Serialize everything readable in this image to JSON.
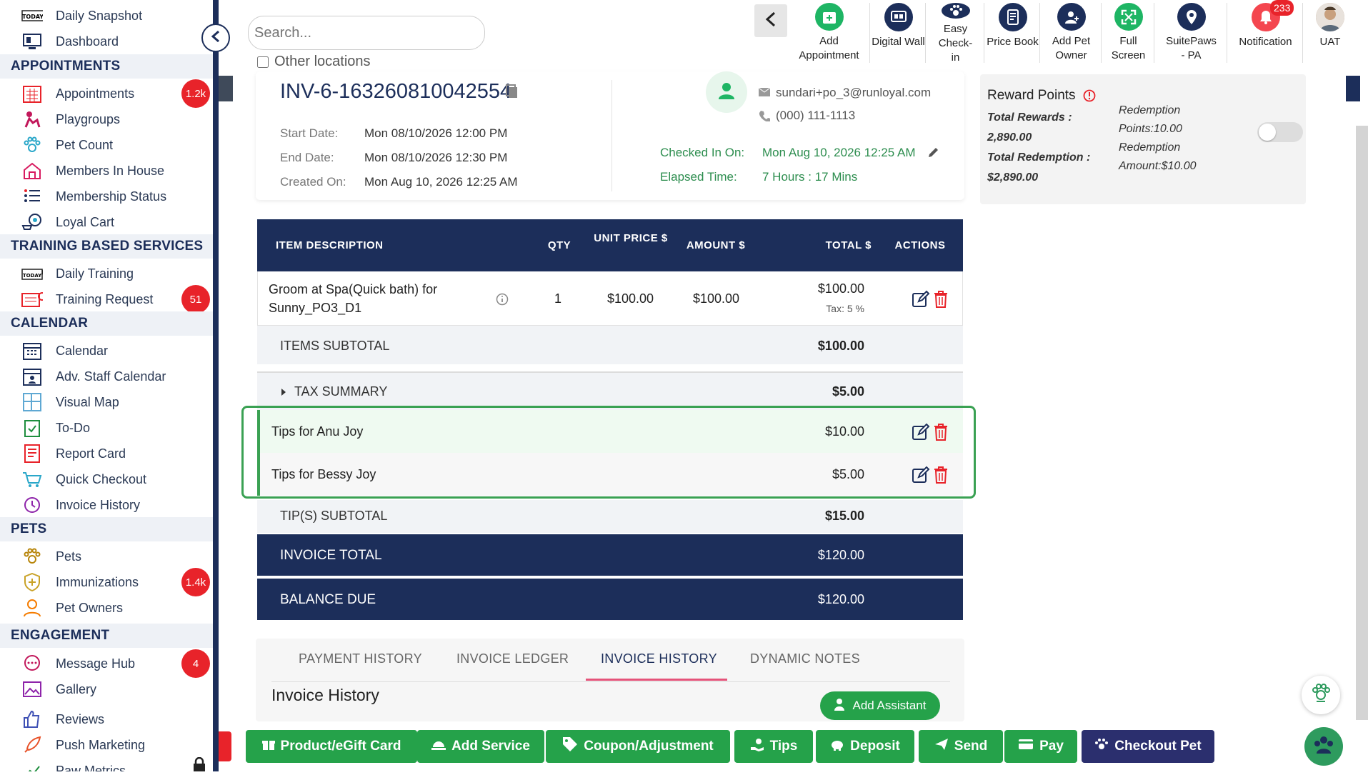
{
  "sidebar": {
    "items_top": [
      {
        "label": "Daily Snapshot",
        "icon": "today-calendar-icon"
      },
      {
        "label": "Dashboard",
        "icon": "dashboard-monitor-icon"
      }
    ],
    "sections": [
      {
        "title": "APPOINTMENTS",
        "items": [
          {
            "label": "Appointments",
            "icon": "calendar-grid-icon",
            "badge": "1.2k"
          },
          {
            "label": "Playgroups",
            "icon": "dog-play-icon"
          },
          {
            "label": "Pet Count",
            "icon": "paw-count-icon"
          },
          {
            "label": "Members In House",
            "icon": "house-icon"
          },
          {
            "label": "Membership Status",
            "icon": "list-status-icon"
          },
          {
            "label": "Loyal Cart",
            "icon": "cart-paw-icon"
          }
        ]
      },
      {
        "title": "TRAINING BASED SERVICES",
        "items": [
          {
            "label": "Daily Training",
            "icon": "today-whistle-icon"
          },
          {
            "label": "Training Request",
            "icon": "training-request-icon",
            "badge": "51"
          }
        ]
      },
      {
        "title": "CALENDAR",
        "items": [
          {
            "label": "Calendar",
            "icon": "calendar-icon"
          },
          {
            "label": "Adv. Staff Calendar",
            "icon": "staff-calendar-icon"
          },
          {
            "label": "Visual Map",
            "icon": "map-grid-icon"
          },
          {
            "label": "To-Do",
            "icon": "todo-clipboard-icon"
          },
          {
            "label": "Report Card",
            "icon": "report-card-icon"
          },
          {
            "label": "Quick Checkout",
            "icon": "quick-cart-icon"
          },
          {
            "label": "Invoice History",
            "icon": "invoice-history-icon"
          }
        ]
      },
      {
        "title": "PETS",
        "items": [
          {
            "label": "Pets",
            "icon": "paw-icon"
          },
          {
            "label": "Immunizations",
            "icon": "shield-plus-icon",
            "badge": "1.4k"
          },
          {
            "label": "Pet Owners",
            "icon": "person-icon"
          }
        ]
      },
      {
        "title": "ENGAGEMENT",
        "items": [
          {
            "label": "Message Hub",
            "icon": "chat-bubble-icon",
            "badge": "4"
          },
          {
            "label": "Gallery",
            "icon": "image-icon"
          },
          {
            "label": "Reviews",
            "icon": "thumbs-up-icon"
          },
          {
            "label": "Push Marketing",
            "icon": "rocket-icon"
          },
          {
            "label": "Paw Metrics",
            "icon": "chart-line-icon"
          }
        ]
      }
    ]
  },
  "topbar": {
    "search_placeholder": "Search...",
    "other_locations": "Other locations",
    "buttons": [
      {
        "label": "Add Appointment",
        "icon": "add-calendar-icon",
        "color": "#1eb564"
      },
      {
        "label": "Digital Wall",
        "icon": "digital-wall-icon",
        "color": "#1c2e5a"
      },
      {
        "label": "Easy Check-in",
        "icon": "paw-checkin-icon",
        "color": "#1c2e5a"
      },
      {
        "label": "Price Book",
        "icon": "price-book-icon",
        "color": "#1c2e5a"
      },
      {
        "label": "Add Pet Owner",
        "icon": "add-user-icon",
        "color": "#1c2e5a"
      },
      {
        "label": "Full Screen",
        "icon": "fullscreen-icon",
        "color": "#1eb564"
      },
      {
        "label": "SuitePaws - PA",
        "icon": "location-pin-icon",
        "color": "#1c2e5a"
      },
      {
        "label": "Notification",
        "icon": "bell-icon",
        "color": "#f4464f",
        "badge": "233"
      },
      {
        "label": "UAT",
        "icon": "user-avatar-icon"
      }
    ]
  },
  "invoice": {
    "number": "INV-6-163260810042554",
    "start_label": "Start Date:",
    "start_value": "Mon 08/10/2026 12:00 PM",
    "end_label": "End Date:",
    "end_value": "Mon 08/10/2026 12:30 PM",
    "created_label": "Created On:",
    "created_value": "Mon Aug 10, 2026 12:25 AM",
    "email": "sundari+po_3@runloyal.com",
    "phone": "(000) 111-1113",
    "checked_in_label": "Checked In On:",
    "checked_in_value": "Mon Aug 10, 2026 12:25 AM",
    "elapsed_label": "Elapsed Time:",
    "elapsed_value": "7 Hours : 17 Mins"
  },
  "rewards": {
    "title": "Reward Points",
    "total_rewards_label": "Total Rewards :",
    "total_rewards_value": "2,890.00",
    "total_redemption_label": "Total Redemption :",
    "total_redemption_value": "$2,890.00",
    "redemption_points": "Redemption Points:10.00",
    "redemption_amount": "Redemption Amount:$10.00"
  },
  "table": {
    "headers": {
      "desc": "ITEM DESCRIPTION",
      "qty": "QTY",
      "unit": "UNIT PRICE $",
      "amount": "AMOUNT $",
      "total": "TOTAL $",
      "actions": "ACTIONS"
    },
    "item": {
      "desc": "Groom at Spa(Quick bath) for Sunny_PO3_D1",
      "qty": "1",
      "unit": "$100.00",
      "amount": "$100.00",
      "total": "$100.00",
      "tax": "Tax: 5 %"
    },
    "items_subtotal_label": "ITEMS SUBTOTAL",
    "items_subtotal": "$100.00",
    "tax_summary_label": "TAX SUMMARY",
    "tax_summary": "$5.00",
    "tips": [
      {
        "label": "Tips for Anu Joy",
        "amount": "$10.00"
      },
      {
        "label": "Tips for Bessy Joy",
        "amount": "$5.00"
      }
    ],
    "tips_subtotal_label": "TIP(S) SUBTOTAL",
    "tips_subtotal": "$15.00",
    "invoice_total_label": "INVOICE TOTAL",
    "invoice_total": "$120.00",
    "balance_due_label": "BALANCE DUE",
    "balance_due": "$120.00"
  },
  "tabs": {
    "items": [
      "PAYMENT HISTORY",
      "INVOICE LEDGER",
      "INVOICE HISTORY",
      "DYNAMIC NOTES"
    ],
    "active": "INVOICE HISTORY",
    "section_title": "Invoice History",
    "add_assistant": "Add Assistant"
  },
  "bottom_buttons": [
    {
      "label": "Product/eGift Card",
      "icon": "gift-icon"
    },
    {
      "label": "Add Service",
      "icon": "service-bell-icon"
    },
    {
      "label": "Coupon/Adjustment",
      "icon": "tag-icon"
    },
    {
      "label": "Tips",
      "icon": "tip-hand-icon"
    },
    {
      "label": "Deposit",
      "icon": "piggy-bank-icon"
    },
    {
      "label": "Send",
      "icon": "paper-plane-icon"
    },
    {
      "label": "Pay",
      "icon": "credit-card-icon"
    },
    {
      "label": "Checkout Pet",
      "icon": "paw-icon"
    }
  ],
  "colors": {
    "navy": "#1c2e5a",
    "green": "#25a24a",
    "red": "#e8232a",
    "highlight_border": "#3aa153"
  }
}
